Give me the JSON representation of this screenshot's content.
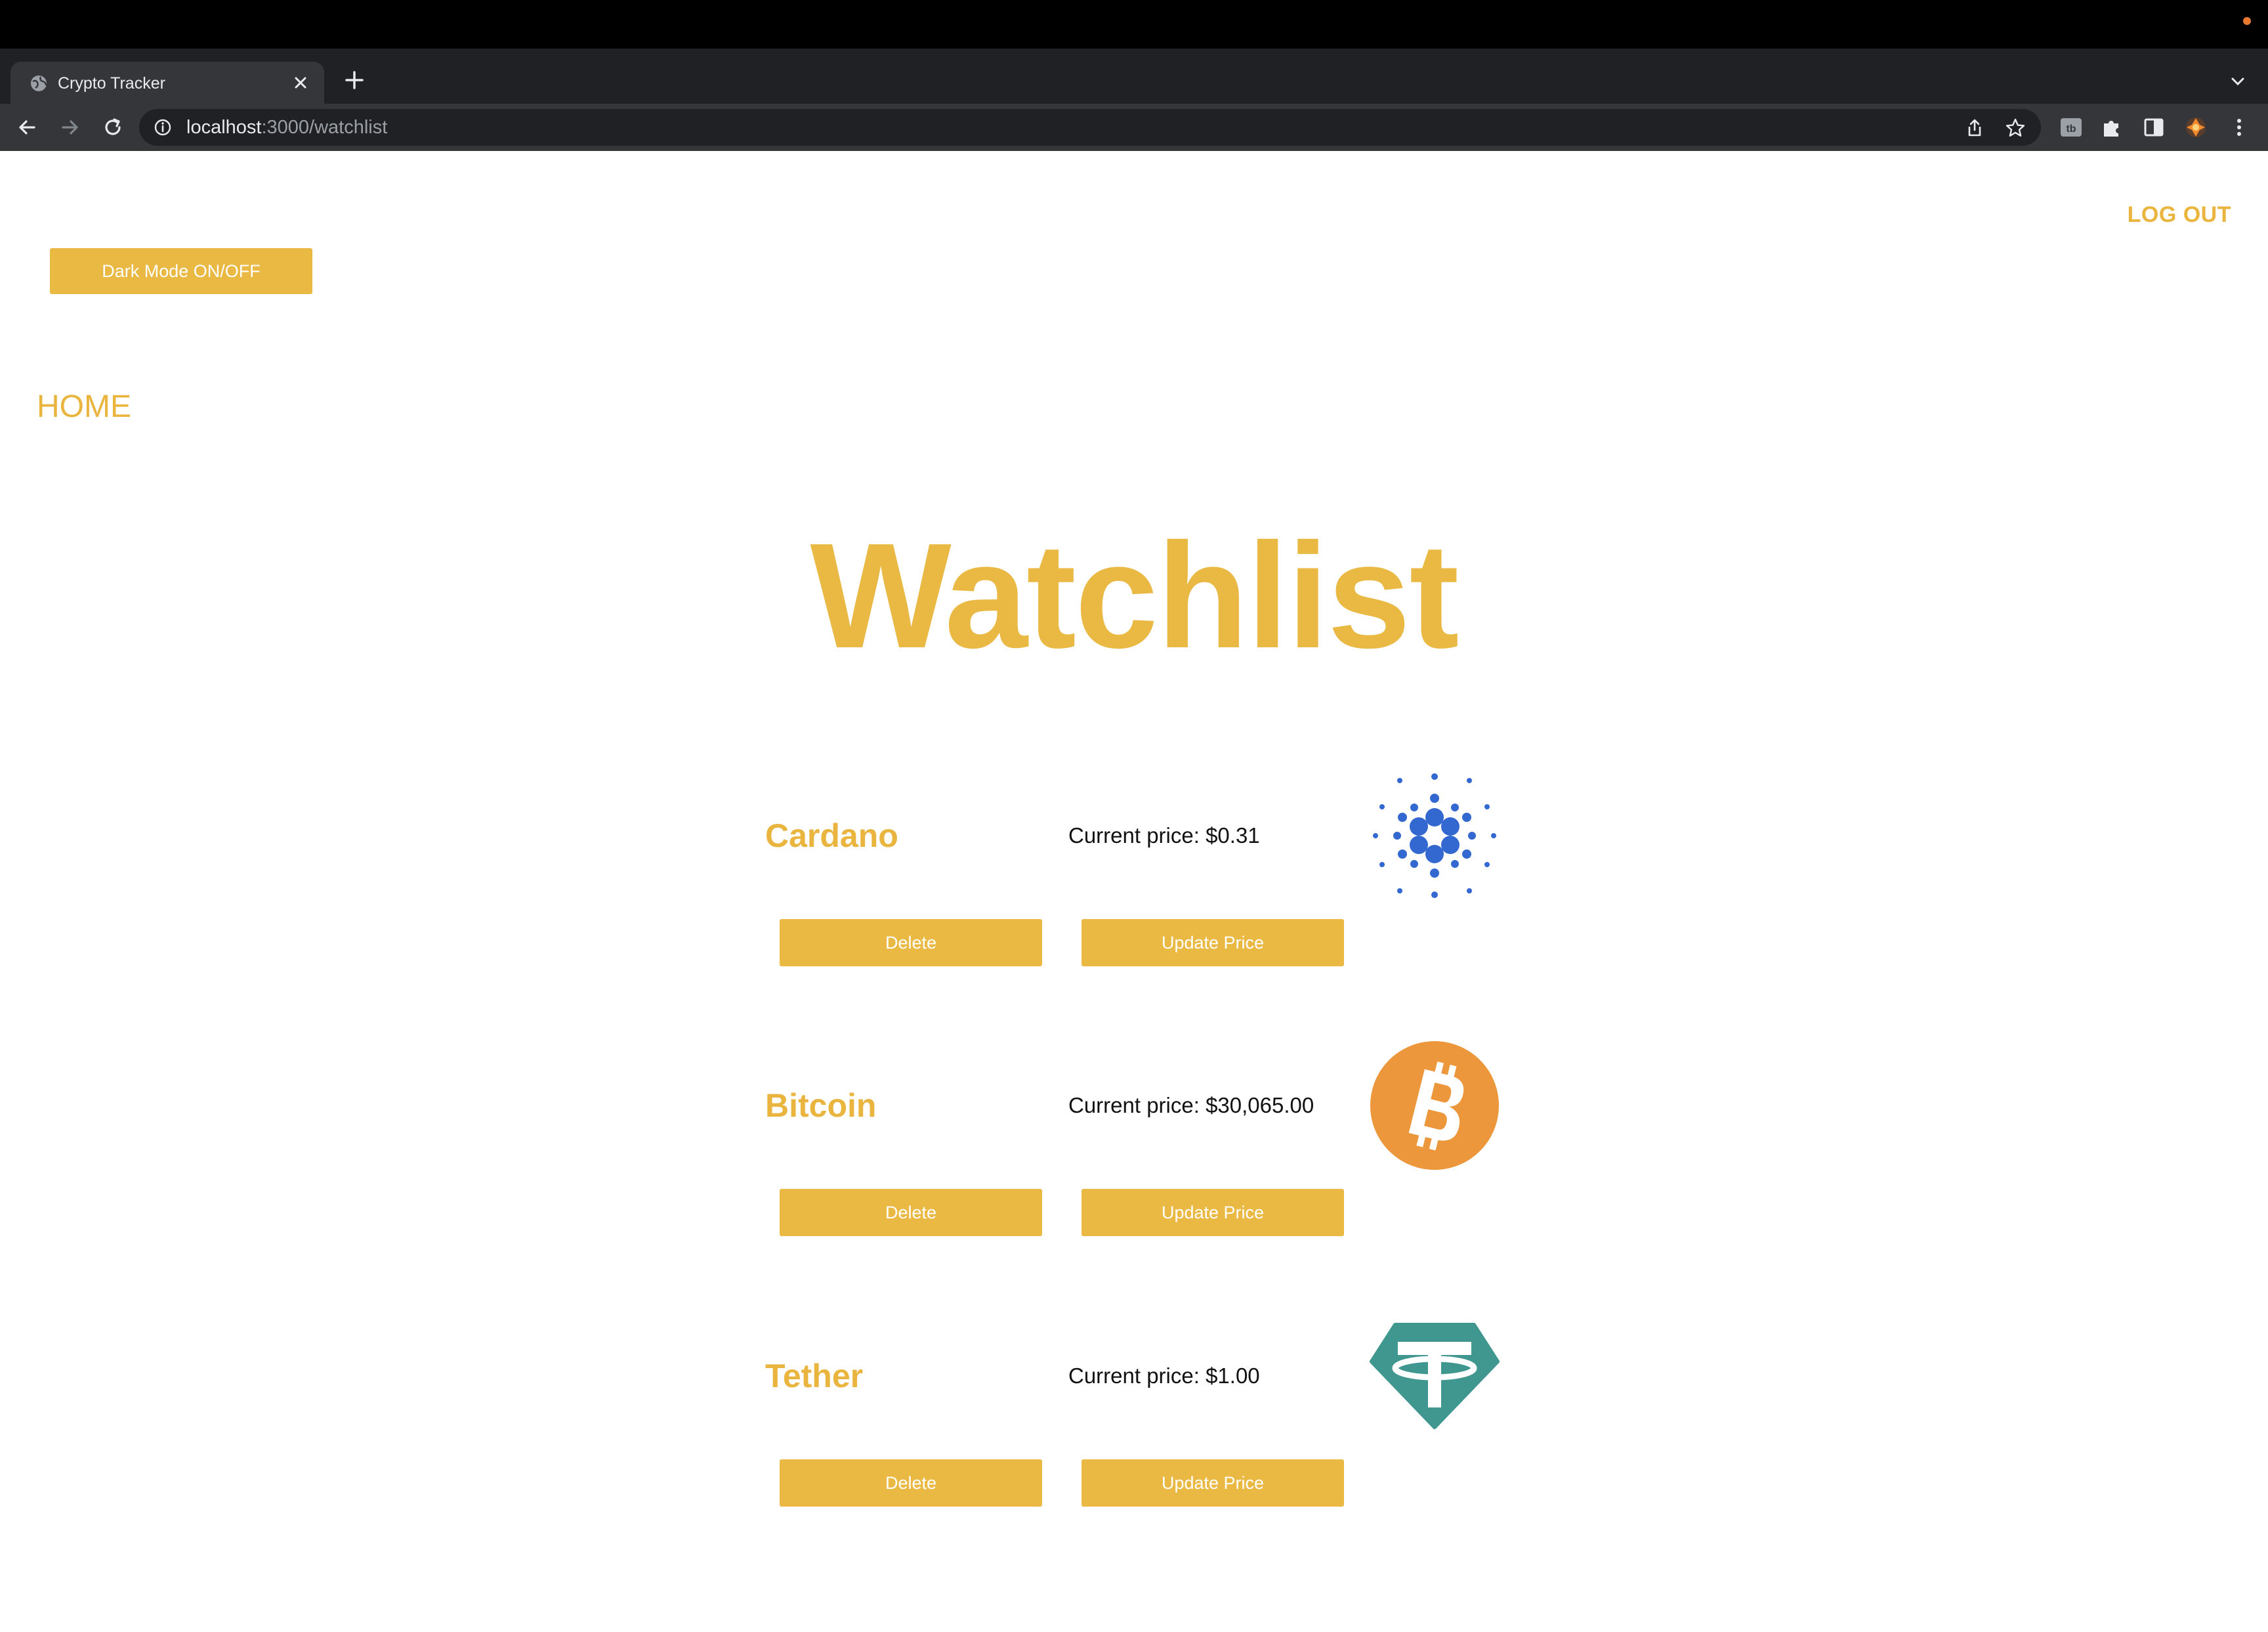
{
  "browser": {
    "tab_title": "Crypto Tracker",
    "url_host": "localhost",
    "url_path": ":3000/watchlist"
  },
  "page": {
    "logout_label": "LOG OUT",
    "dark_mode_label": "Dark Mode ON/OFF",
    "home_label": "HOME",
    "heading": "Watchlist",
    "delete_label": "Delete",
    "update_label": "Update Price"
  },
  "coins": [
    {
      "name": "Cardano",
      "price": "Current price: $0.31",
      "logo": "cardano-icon"
    },
    {
      "name": "Bitcoin",
      "price": "Current price: $30,065.00",
      "logo": "bitcoin-icon"
    },
    {
      "name": "Tether",
      "price": "Current price: $1.00",
      "logo": "tether-icon"
    }
  ],
  "colors": {
    "accent": "#e9b944",
    "cardano": "#3468d1",
    "bitcoin": "#ec973c",
    "tether": "#3f9790"
  }
}
